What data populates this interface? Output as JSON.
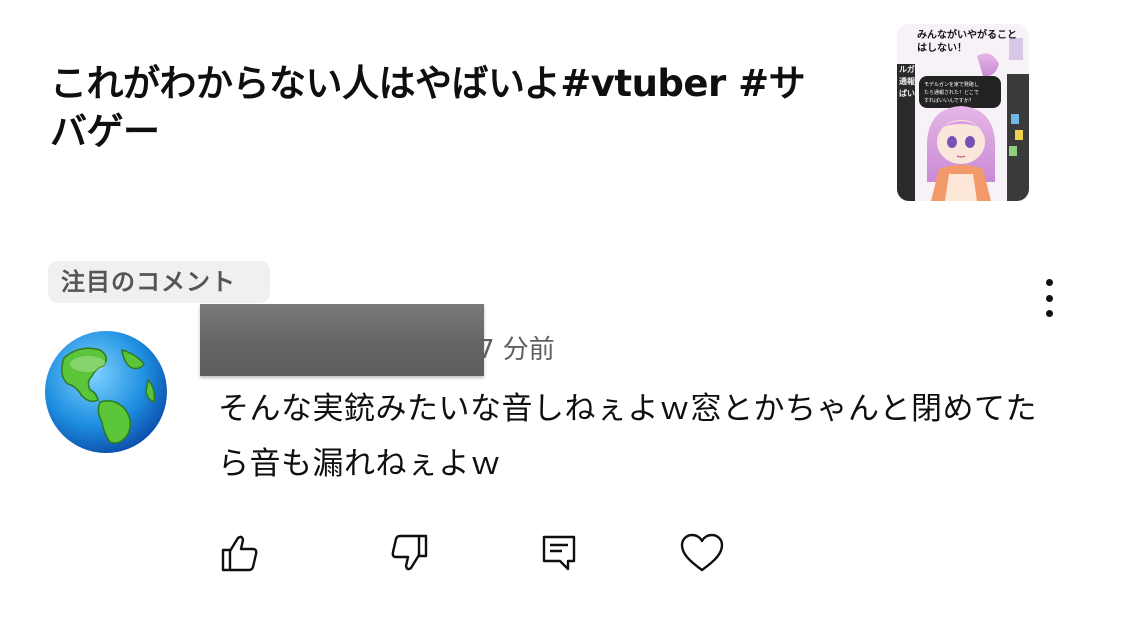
{
  "video": {
    "title": "これがわからない人はやばいよ#vtuber #サバゲー",
    "thumbnail": {
      "headline_line1": "みんながいやがること",
      "headline_line2": "はしない！",
      "bubble_line1": "モデルガンを家で発砲し",
      "bubble_line2": "たら通報された！どこで",
      "bubble_line3": "すればいいんですか？",
      "side_text_1": "ルガ",
      "side_text_2": "通報",
      "side_text_3": "ばい"
    }
  },
  "comments": {
    "section_label": "注目のコメント",
    "comment": {
      "timestamp": "7 分前",
      "text": "そんな実銃みたいな音しねぇよｗ窓とかちゃんと閉めてたら音も漏れねぇよｗ"
    }
  },
  "colors": {
    "text_primary": "#0f0f0f",
    "text_secondary": "#606060",
    "chip_background": "#f0f0f0",
    "redaction": "#686868"
  },
  "icons": {
    "like": "thumbs-up-icon",
    "dislike": "thumbs-down-icon",
    "reply": "reply-comment-icon",
    "heart": "heart-icon",
    "more": "more-vertical-icon"
  }
}
